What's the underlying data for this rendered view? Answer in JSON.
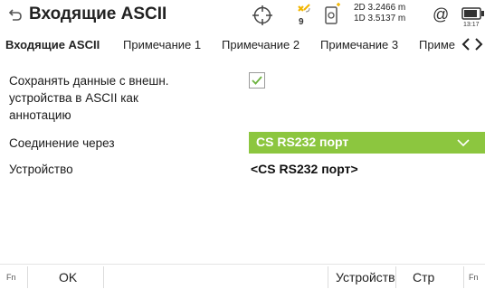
{
  "header": {
    "title": "Входящие ASCII",
    "satellites": "9",
    "accuracy_2d": "2D 3.2466 m",
    "accuracy_1d": "1D 3.5137 m",
    "at_symbol": "@",
    "time": "13:17"
  },
  "tabs": [
    {
      "label": "Входящие ASCII",
      "active": true
    },
    {
      "label": "Примечание 1",
      "active": false
    },
    {
      "label": "Примечание 2",
      "active": false
    },
    {
      "label": "Примечание 3",
      "active": false
    },
    {
      "label": "Приме",
      "active": false
    }
  ],
  "form": {
    "save_label_line1": "Сохранять данные с внешн.",
    "save_label_line2": "устройства в  ASCII как",
    "save_label_line3": "аннотацию",
    "save_checked": true,
    "connection_label": "Соединение через",
    "connection_value": "CS RS232 порт",
    "device_label": "Устройство",
    "device_value": "<CS RS232 порт>"
  },
  "bottom": {
    "fn_left": "Fn",
    "ok_label": "OK",
    "devices_label": "Устройств",
    "page_label": "Стр",
    "fn_right": "Fn"
  },
  "colors": {
    "accent_green": "#8cc63f",
    "check_green": "#6db33f",
    "satellite_yellow": "#f2b600"
  }
}
